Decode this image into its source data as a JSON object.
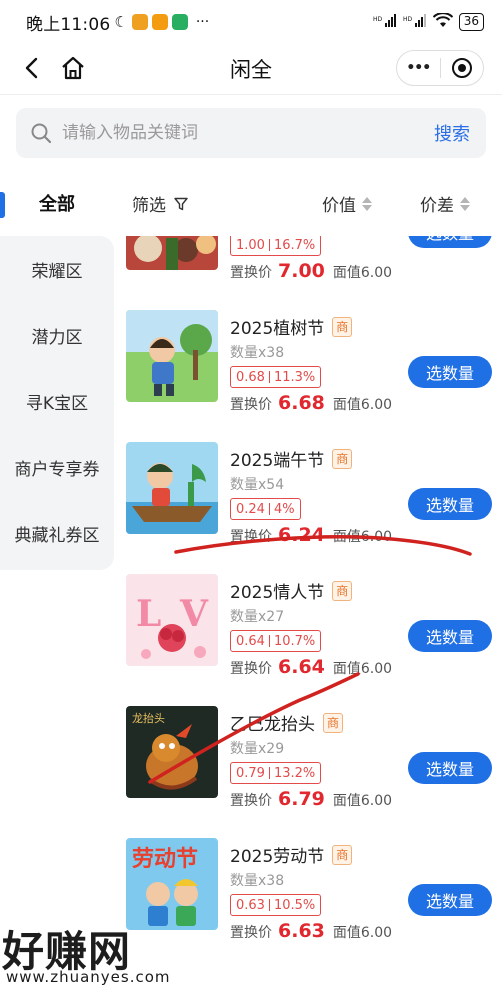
{
  "status_bar": {
    "time": "晚上11:06",
    "battery": "36",
    "network": "HD"
  },
  "nav": {
    "title": "闲全",
    "more": "•••"
  },
  "search": {
    "placeholder": "请输入物品关键词",
    "button": "搜索"
  },
  "sidebar": {
    "items": [
      {
        "label": "全部",
        "active": true
      },
      {
        "label": "荣耀区"
      },
      {
        "label": "潜力区"
      },
      {
        "label": "寻K宝区"
      },
      {
        "label": "商户专享券"
      },
      {
        "label": "典藏礼券区"
      }
    ]
  },
  "filters": {
    "filter": "筛选",
    "value": "价值",
    "diff": "价差"
  },
  "products": [
    {
      "name": "",
      "tag": "",
      "qty": "",
      "rate": "1.00",
      "pct": "16.7%",
      "price_label": "置换价",
      "price": "7.00",
      "face": "面值6.00",
      "button": "选数量"
    },
    {
      "name": "2025植树节",
      "tag": "商",
      "qty": "数量x38",
      "rate": "0.68",
      "pct": "11.3%",
      "price_label": "置换价",
      "price": "6.68",
      "face": "面值6.00",
      "button": "选数量"
    },
    {
      "name": "2025端午节",
      "tag": "商",
      "qty": "数量x54",
      "rate": "0.24",
      "pct": "4%",
      "price_label": "置换价",
      "price": "6.24",
      "face": "面值6.00",
      "button": "选数量"
    },
    {
      "name": "2025情人节",
      "tag": "商",
      "qty": "数量x27",
      "rate": "0.64",
      "pct": "10.7%",
      "price_label": "置换价",
      "price": "6.64",
      "face": "面值6.00",
      "button": "选数量"
    },
    {
      "name": "乙巳龙抬头",
      "tag": "商",
      "qty": "数量x29",
      "rate": "0.79",
      "pct": "13.2%",
      "price_label": "置换价",
      "price": "6.79",
      "face": "面值6.00",
      "button": "选数量"
    },
    {
      "name": "2025劳动节",
      "tag": "商",
      "qty": "数量x38",
      "rate": "0.63",
      "pct": "10.5%",
      "price_label": "置换价",
      "price": "6.63",
      "face": "面值6.00",
      "button": "选数量"
    }
  ],
  "thumb_captions": {
    "dragon": "龙抬头",
    "labor": "劳动节"
  },
  "watermark": {
    "text": "好赚网",
    "url": "www.zhuanyes.com"
  },
  "colors": {
    "accent": "#1f6fe5",
    "price_red": "#e0282e",
    "marker_red": "#d0231f"
  }
}
